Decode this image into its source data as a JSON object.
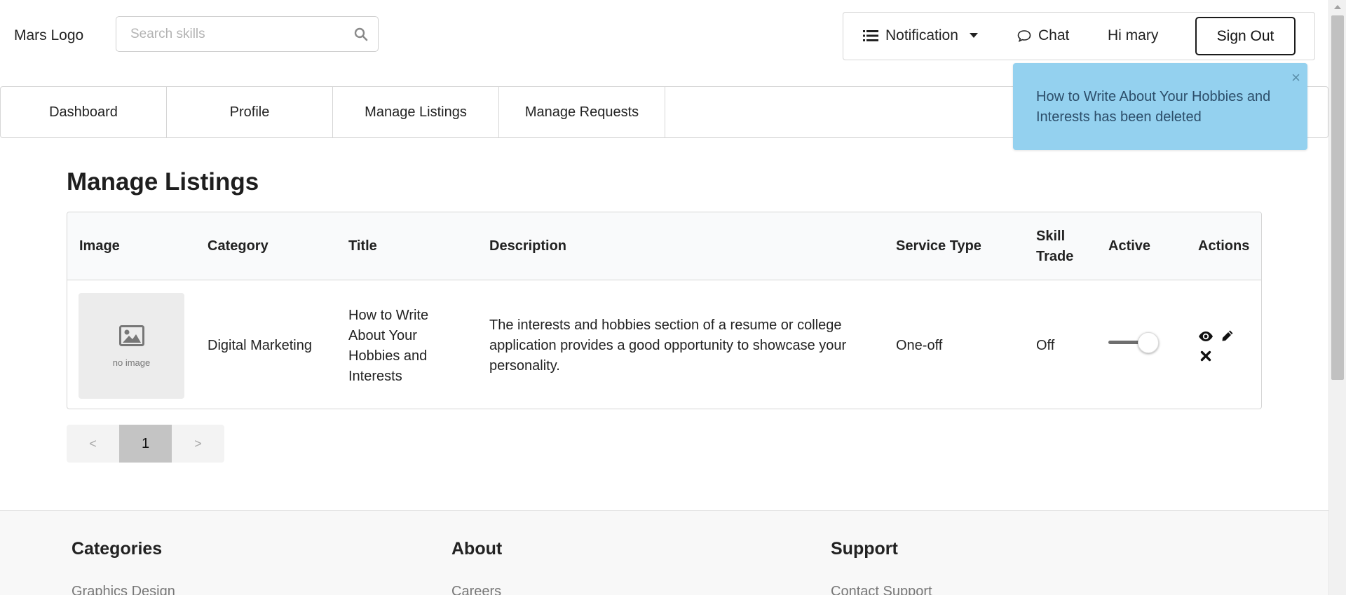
{
  "header": {
    "logo": "Mars Logo",
    "search_placeholder": "Search skills",
    "notification_label": "Notification",
    "chat_label": "Chat",
    "greeting": "Hi mary",
    "signout_label": "Sign Out"
  },
  "tabs": [
    "Dashboard",
    "Profile",
    "Manage Listings",
    "Manage Requests"
  ],
  "toast": {
    "message": "How to Write About Your Hobbies and Interests has been deleted",
    "close": "×",
    "color": "#94d1ef"
  },
  "page_title": "Manage Listings",
  "table": {
    "headers": {
      "image": "Image",
      "category": "Category",
      "title": "Title",
      "description": "Description",
      "service_type": "Service Type",
      "skill_trade": "Skill Trade",
      "active": "Active",
      "actions": "Actions"
    },
    "rows": [
      {
        "image_text": "no image",
        "category": "Digital Marketing",
        "title": "How to Write About Your Hobbies and Interests",
        "description": "The interests and hobbies section of a resume or college application provides a good opportunity to showcase your personality.",
        "service_type": "One-off",
        "skill_trade": "Off",
        "active": true,
        "action_icons": [
          "eye-icon",
          "pencil-icon",
          "close-icon"
        ]
      }
    ]
  },
  "pagination": {
    "prev": "<",
    "current": "1",
    "next": ">"
  },
  "footer": {
    "columns": [
      {
        "heading": "Categories",
        "first_link": "Graphics Design"
      },
      {
        "heading": "About",
        "first_link": "Careers"
      },
      {
        "heading": "Support",
        "first_link": "Contact Support"
      }
    ]
  }
}
